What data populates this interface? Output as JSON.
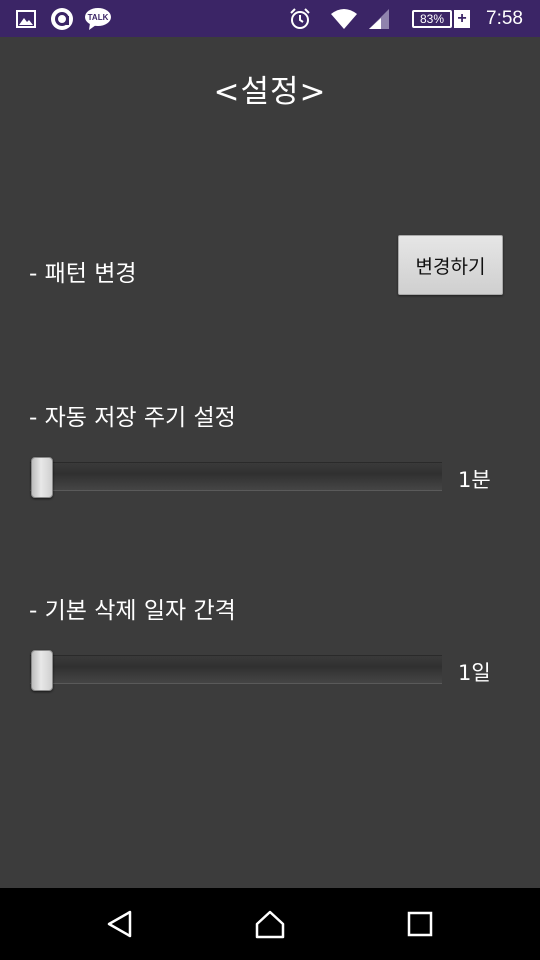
{
  "status_bar": {
    "notifications": [
      "gallery-icon",
      "a-circle-icon",
      "talk-icon"
    ],
    "talk_label": "TALK",
    "battery_percent": "83%",
    "battery_plus": "+",
    "time": "7:58",
    "background": "#3b2566"
  },
  "page": {
    "title": "<설정>",
    "pattern": {
      "label": "- 패턴 변경",
      "button_label": "변경하기"
    },
    "autosave": {
      "label": "- 자동 저장 주기 설정",
      "value_label": "1분",
      "slider_position": 0
    },
    "delete_interval": {
      "label": "- 기본 삭제 일자 간격",
      "value_label": "1일",
      "slider_position": 0
    },
    "background": "#3c3c3c"
  },
  "nav_bar": {
    "buttons": [
      "back-icon",
      "home-icon",
      "recent-apps-icon"
    ]
  }
}
